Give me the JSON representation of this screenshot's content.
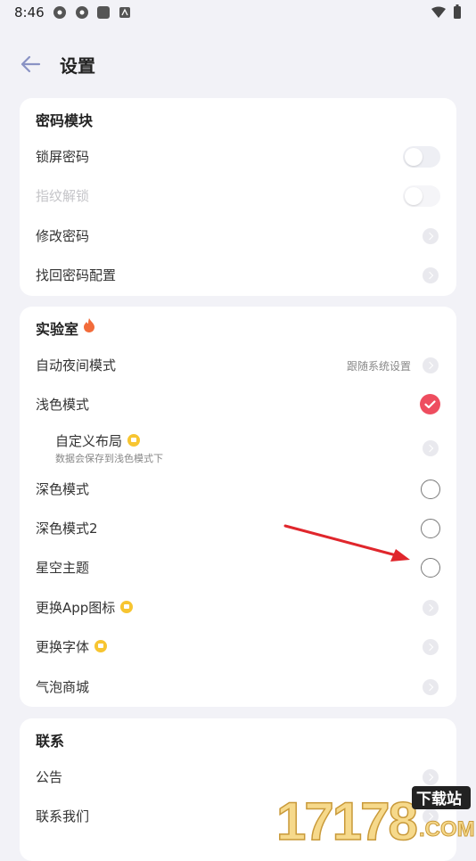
{
  "status": {
    "time": "8:46"
  },
  "header": {
    "title": "设置"
  },
  "section1": {
    "title": "密码模块",
    "items": [
      {
        "label": "锁屏密码"
      },
      {
        "label": "指纹解锁"
      },
      {
        "label": "修改密码"
      },
      {
        "label": "找回密码配置"
      }
    ]
  },
  "section2": {
    "title": "实验室",
    "items": [
      {
        "label": "自动夜间模式",
        "value": "跟随系统设置"
      },
      {
        "label": "浅色模式"
      },
      {
        "label": "自定义布局",
        "sub": "数据会保存到浅色模式下"
      },
      {
        "label": "深色模式"
      },
      {
        "label": "深色模式2"
      },
      {
        "label": "星空主题"
      },
      {
        "label": "更换App图标"
      },
      {
        "label": "更换字体"
      },
      {
        "label": "气泡商城"
      }
    ]
  },
  "section3": {
    "title": "联系",
    "items": [
      {
        "label": "公告"
      },
      {
        "label": "联系我们"
      }
    ]
  },
  "watermark": {
    "text": "17178",
    "site": "下载站",
    "domain": ".COM"
  },
  "colors": {
    "accent": "#ee4d5f",
    "badge": "#f7c531",
    "arrow": "#e0262c",
    "background": "#f2f2f7"
  }
}
